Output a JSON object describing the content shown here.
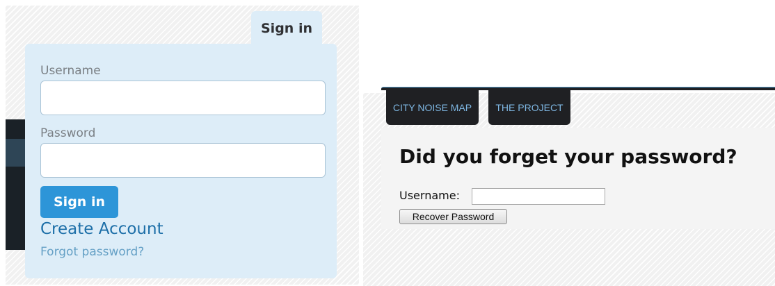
{
  "signin": {
    "tab_label": "Sign in",
    "username_label": "Username",
    "username_value": "",
    "password_label": "Password",
    "password_value": "",
    "submit_label": "Sign in",
    "create_account_label": "Create Account",
    "forgot_password_label": "Forgot password?"
  },
  "recover": {
    "nav_tabs": [
      {
        "label": "CITY NOISE MAP"
      },
      {
        "label": "THE PROJECT"
      }
    ],
    "title": "Did you forget your password?",
    "username_label": "Username:",
    "username_value": "",
    "button_label": "Recover Password"
  },
  "colors": {
    "signin_bg": "#ddedf8",
    "button_blue": "#2d95d8",
    "link_blue": "#1d6fa8",
    "nav_dark": "#1f2023",
    "nav_text": "#7fb8e4"
  }
}
